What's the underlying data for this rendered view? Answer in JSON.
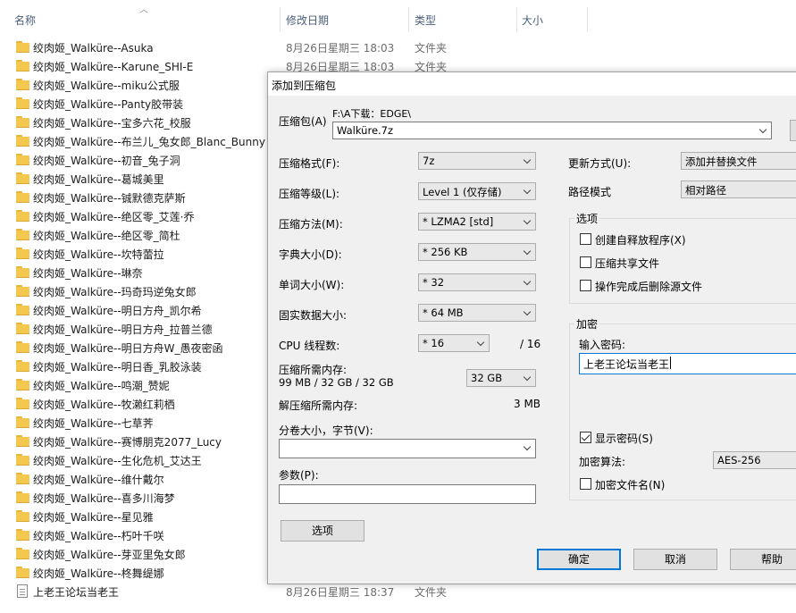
{
  "explorer": {
    "columns": {
      "name": "名称",
      "date": "修改日期",
      "type": "类型",
      "size": "大小"
    },
    "rows": [
      {
        "name": "绞肉姬_Walküre--Asuka",
        "date": "8月26日星期三 18:03",
        "type": "文件夹"
      },
      {
        "name": "绞肉姬_Walküre--Karune_SHI-E",
        "date": "8月26日星期三 18:03",
        "type": "文件夹"
      },
      {
        "name": "绞肉姬_Walküre--miku公式服",
        "date": "",
        "type": ""
      },
      {
        "name": "绞肉姬_Walküre--Panty胶带装",
        "date": "",
        "type": ""
      },
      {
        "name": "绞肉姬_Walküre--宝多六花_校服",
        "date": "",
        "type": ""
      },
      {
        "name": "绞肉姬_Walküre--布兰儿_兔女郎_Blanc_Bunny",
        "date": "",
        "type": ""
      },
      {
        "name": "绞肉姬_Walküre--初音_兔子洞",
        "date": "",
        "type": ""
      },
      {
        "name": "绞肉姬_Walküre--葛城美里",
        "date": "",
        "type": ""
      },
      {
        "name": "绞肉姬_Walküre--铖默德克萨斯",
        "date": "",
        "type": ""
      },
      {
        "name": "绞肉姬_Walküre--绝区零_艾莲·乔",
        "date": "",
        "type": ""
      },
      {
        "name": "绞肉姬_Walküre--绝区零_简杜",
        "date": "",
        "type": ""
      },
      {
        "name": "绞肉姬_Walküre--坎特蕾拉",
        "date": "",
        "type": ""
      },
      {
        "name": "绞肉姬_Walküre--琳奈",
        "date": "",
        "type": ""
      },
      {
        "name": "绞肉姬_Walküre--玛奇玛逆兔女郎",
        "date": "",
        "type": ""
      },
      {
        "name": "绞肉姬_Walküre--明日方舟_凯尔希",
        "date": "",
        "type": ""
      },
      {
        "name": "绞肉姬_Walküre--明日方舟_拉普兰德",
        "date": "",
        "type": ""
      },
      {
        "name": "绞肉姬_Walküre--明日方舟W_愚夜密函",
        "date": "",
        "type": ""
      },
      {
        "name": "绞肉姬_Walküre--明日香_乳胶泳装",
        "date": "",
        "type": ""
      },
      {
        "name": "绞肉姬_Walküre--鸣潮_赞妮",
        "date": "",
        "type": ""
      },
      {
        "name": "绞肉姬_Walküre--牧濑红莉栖",
        "date": "",
        "type": ""
      },
      {
        "name": "绞肉姬_Walküre--七草荠",
        "date": "",
        "type": ""
      },
      {
        "name": "绞肉姬_Walküre--赛博朋克2077_Lucy",
        "date": "",
        "type": ""
      },
      {
        "name": "绞肉姬_Walküre--生化危机_艾达王",
        "date": "",
        "type": ""
      },
      {
        "name": "绞肉姬_Walküre--维什戴尔",
        "date": "",
        "type": ""
      },
      {
        "name": "绞肉姬_Walküre--喜多川海梦",
        "date": "",
        "type": ""
      },
      {
        "name": "绞肉姬_Walküre--星见雅",
        "date": "",
        "type": ""
      },
      {
        "name": "绞肉姬_Walküre--朽叶千咲",
        "date": "",
        "type": ""
      },
      {
        "name": "绞肉姬_Walküre--芽亚里兔女郎",
        "date": "",
        "type": ""
      },
      {
        "name": "绞肉姬_Walküre--柊舞缇娜",
        "date": "",
        "type": ""
      },
      {
        "name": "上老王论坛当老王",
        "date": "8月26日星期三 18:37",
        "type": "文件夹",
        "icon": "text-file-icon"
      }
    ]
  },
  "dialog": {
    "title": "添加到压缩包",
    "archive_label": "压缩包(A)",
    "archive_path": "F:\\A下载：EDGE\\",
    "archive_name": "Walküre.7z",
    "format_label": "压缩格式(F):",
    "format_value": "7z",
    "level_label": "压缩等级(L):",
    "level_value": "Level 1 (仅存储)",
    "method_label": "压缩方法(M):",
    "method_value": "* LZMA2 [std]",
    "dict_label": "字典大小(D):",
    "dict_value": "* 256 KB",
    "word_label": "单词大小(W):",
    "word_value": "* 32",
    "solid_label": "固实数据大小:",
    "solid_value": "* 64 MB",
    "threads_label": "CPU 线程数:",
    "threads_value": "* 16",
    "threads_total": "/ 16",
    "mem_comp_label": "压缩所需内存:",
    "mem_comp_detail": "99 MB / 32 GB / 32 GB",
    "mem_limit_value": "32 GB",
    "mem_decomp_label": "解压缩所需内存:",
    "mem_decomp_value": "3 MB",
    "volume_label": "分卷大小，字节(V):",
    "volume_value": "",
    "params_label": "参数(P):",
    "params_value": "",
    "options_button": "选项",
    "update_label": "更新方式(U):",
    "update_value": "添加并替换文件",
    "pathmode_label": "路径模式",
    "pathmode_value": "相对路径",
    "options_group": "选项",
    "opt_sfx": "创建自释放程序(X)",
    "opt_shared": "压缩共享文件",
    "opt_delete": "操作完成后删除源文件",
    "encrypt_group": "加密",
    "password_label": "输入密码:",
    "password_value": "上老王论坛当老王",
    "show_password": "显示密码(S)",
    "show_password_checked": true,
    "enc_method_label": "加密算法:",
    "enc_method_value": "AES-256",
    "enc_names": "加密文件名(N)",
    "ok_button": "确定",
    "cancel_button": "取消",
    "help_button": "帮助"
  }
}
